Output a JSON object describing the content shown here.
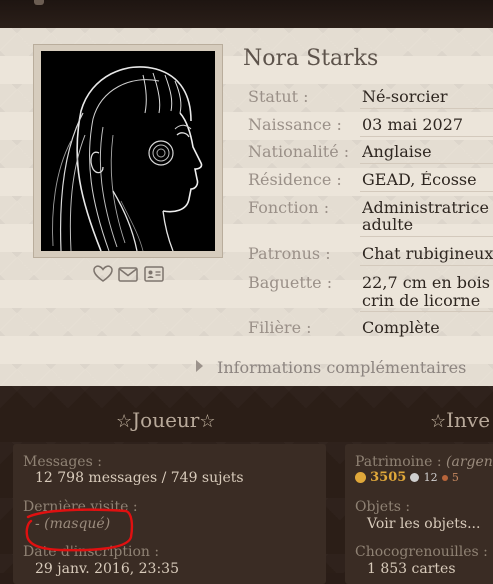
{
  "header": {},
  "profile": {
    "name": "Nora Starks",
    "fields": [
      {
        "label": "Statut :",
        "value": "Né-sorcier"
      },
      {
        "label": "Naissance :",
        "value": "03 mai 2027"
      },
      {
        "label": "Nationalité :",
        "value": "Anglaise"
      },
      {
        "label": "Résidence :",
        "value": "GEAD, Écosse"
      },
      {
        "label": "Fonction :",
        "value": "Administratrice",
        "value2": "adulte"
      },
      {
        "label": "Patronus :",
        "value": "Chat rubigineux"
      },
      {
        "label": "Baguette :",
        "value": "22,7 cm en bois",
        "value2": "crin de licorne"
      },
      {
        "label": "Filière :",
        "value": "Complète"
      }
    ],
    "more_info": "Informations complémentaires",
    "icons": [
      "heart-icon",
      "envelope-icon",
      "id-card-icon"
    ]
  },
  "joueur": {
    "title": "Joueur",
    "messages_label": "Messages :",
    "messages_value": "12 798 messages / 749 sujets",
    "last_visit_label": "Dernière visite :",
    "last_visit_value": "- (masqué)",
    "inscription_label": "Date d'inscription :",
    "inscription_value": "29 janv. 2016, 23:35"
  },
  "inventaire": {
    "title": "Inve",
    "patrimoine_label": "Patrimoine :",
    "patrimoine_hint": "(argen",
    "gold": "3505",
    "silver": "12",
    "bronze": "5",
    "objets_label": "Objets :",
    "objets_link": "Voir les objets...",
    "choco_label": "Chocogrenouilles :",
    "choco_value": "1 853 cartes"
  },
  "colors": {
    "gold": "#e0a83a",
    "silver": "#cfcfcf",
    "bronze": "#b8643a",
    "annotation": "#e01010"
  }
}
